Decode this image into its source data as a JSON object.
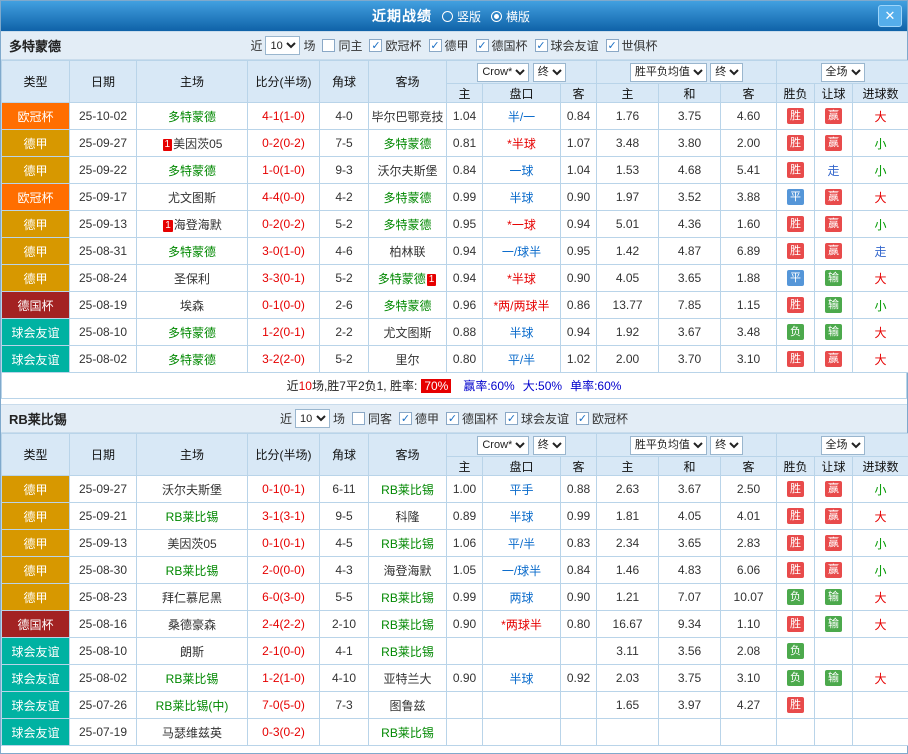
{
  "colors": {
    "leagues": {
      "欧冠杯": "#FF6E00",
      "德甲": "#D79800",
      "德国杯": "#A32222",
      "球会友谊": "#00B2A2"
    },
    "badge_win": "#E84B4B",
    "badge_draw": "#5596D8",
    "badge_loss": "#4CA94C",
    "text_big": "#E60000",
    "text_small": "#009900",
    "text_push": "#3366CC",
    "score": "#E60000",
    "focus_team": "#008800",
    "titlebar": "#1E7CC0"
  },
  "icons": {
    "check": "✓",
    "close": "✕"
  },
  "titlebar": {
    "title": "近期战绩",
    "radios": [
      {
        "label": "竖版",
        "selected": false
      },
      {
        "label": "横版",
        "selected": true
      }
    ]
  },
  "table_header": {
    "type": "类型",
    "date": "日期",
    "home": "主场",
    "score": "比分(半场)",
    "corner": "角球",
    "away": "客场",
    "odds_source": "Crow*",
    "odds_final": "终",
    "avg_source": "胜平负均值",
    "avg_final": "终",
    "scope": "全场",
    "odds_home": "主",
    "odds_line": "盘口",
    "odds_away": "客",
    "avg_home": "主",
    "avg_draw": "和",
    "avg_away": "客",
    "result": "胜负",
    "handicap": "让球",
    "goals": "进球数"
  },
  "sections": [
    {
      "team": "多特蒙德",
      "filters": {
        "near": "近",
        "count": "10",
        "games": "场",
        "checks": [
          {
            "label": "同主",
            "checked": false
          },
          {
            "label": "欧冠杯",
            "checked": true
          },
          {
            "label": "德甲",
            "checked": true
          },
          {
            "label": "德国杯",
            "checked": true
          },
          {
            "label": "球会友谊",
            "checked": true
          },
          {
            "label": "世俱杯",
            "checked": true
          }
        ]
      },
      "rows": [
        {
          "league": "欧冠杯",
          "date": "25-10-02",
          "home": {
            "name": "多特蒙德",
            "focus": true
          },
          "score": "4-1(1-0)",
          "corner": "4-0",
          "away": {
            "name": "毕尔巴鄂竞技"
          },
          "odds": [
            "1.04",
            "半/一",
            "0.84"
          ],
          "avg": [
            "1.76",
            "3.75",
            "4.60"
          ],
          "result": "胜",
          "handicap": "赢",
          "goals": "大"
        },
        {
          "league": "德甲",
          "date": "25-09-27",
          "home": {
            "name": "美因茨05",
            "card": "1",
            "card_pos": "left"
          },
          "score": "0-2(0-2)",
          "corner": "7-5",
          "away": {
            "name": "多特蒙德",
            "focus": true
          },
          "odds": [
            "0.81",
            "*半球",
            "1.07"
          ],
          "avg": [
            "3.48",
            "3.80",
            "2.00"
          ],
          "result": "胜",
          "handicap": "赢",
          "goals": "小"
        },
        {
          "league": "德甲",
          "date": "25-09-22",
          "home": {
            "name": "多特蒙德",
            "focus": true
          },
          "score": "1-0(1-0)",
          "corner": "9-3",
          "away": {
            "name": "沃尔夫斯堡"
          },
          "odds": [
            "0.84",
            "一球",
            "1.04"
          ],
          "avg": [
            "1.53",
            "4.68",
            "5.41"
          ],
          "result": "胜",
          "handicap": "走",
          "goals": "小"
        },
        {
          "league": "欧冠杯",
          "date": "25-09-17",
          "home": {
            "name": "尤文图斯"
          },
          "score": "4-4(0-0)",
          "corner": "4-2",
          "away": {
            "name": "多特蒙德",
            "focus": true
          },
          "odds": [
            "0.99",
            "半球",
            "0.90"
          ],
          "avg": [
            "1.97",
            "3.52",
            "3.88"
          ],
          "result": "平",
          "handicap": "赢",
          "goals": "大"
        },
        {
          "league": "德甲",
          "date": "25-09-13",
          "home": {
            "name": "海登海默",
            "card": "1",
            "card_pos": "left"
          },
          "score": "0-2(0-2)",
          "corner": "5-2",
          "away": {
            "name": "多特蒙德",
            "focus": true
          },
          "odds": [
            "0.95",
            "*一球",
            "0.94"
          ],
          "avg": [
            "5.01",
            "4.36",
            "1.60"
          ],
          "result": "胜",
          "handicap": "赢",
          "goals": "小"
        },
        {
          "league": "德甲",
          "date": "25-08-31",
          "home": {
            "name": "多特蒙德",
            "focus": true
          },
          "score": "3-0(1-0)",
          "corner": "4-6",
          "away": {
            "name": "柏林联"
          },
          "odds": [
            "0.94",
            "一/球半",
            "0.95"
          ],
          "avg": [
            "1.42",
            "4.87",
            "6.89"
          ],
          "result": "胜",
          "handicap": "赢",
          "goals": "走"
        },
        {
          "league": "德甲",
          "date": "25-08-24",
          "home": {
            "name": "圣保利"
          },
          "score": "3-3(0-1)",
          "corner": "5-2",
          "away": {
            "name": "多特蒙德",
            "focus": true,
            "card": "1",
            "card_pos": "right"
          },
          "odds": [
            "0.94",
            "*半球",
            "0.90"
          ],
          "avg": [
            "4.05",
            "3.65",
            "1.88"
          ],
          "result": "平",
          "handicap": "输",
          "goals": "大"
        },
        {
          "league": "德国杯",
          "date": "25-08-19",
          "home": {
            "name": "埃森"
          },
          "score": "0-1(0-0)",
          "corner": "2-6",
          "away": {
            "name": "多特蒙德",
            "focus": true
          },
          "odds": [
            "0.96",
            "*两/两球半",
            "0.86"
          ],
          "avg": [
            "13.77",
            "7.85",
            "1.15"
          ],
          "result": "胜",
          "handicap": "输",
          "goals": "小"
        },
        {
          "league": "球会友谊",
          "date": "25-08-10",
          "home": {
            "name": "多特蒙德",
            "focus": true
          },
          "score": "1-2(0-1)",
          "corner": "2-2",
          "away": {
            "name": "尤文图斯"
          },
          "odds": [
            "0.88",
            "半球",
            "0.94"
          ],
          "avg": [
            "1.92",
            "3.67",
            "3.48"
          ],
          "result": "负",
          "handicap": "输",
          "goals": "大"
        },
        {
          "league": "球会友谊",
          "date": "25-08-02",
          "home": {
            "name": "多特蒙德",
            "focus": true
          },
          "score": "3-2(2-0)",
          "corner": "5-2",
          "away": {
            "name": "里尔"
          },
          "odds": [
            "0.80",
            "平/半",
            "1.02"
          ],
          "avg": [
            "2.00",
            "3.70",
            "3.10"
          ],
          "result": "胜",
          "handicap": "赢",
          "goals": "大"
        }
      ],
      "summary": [
        {
          "text": "近",
          "style": "plain"
        },
        {
          "text": "10",
          "style": "red"
        },
        {
          "text": "场,胜7平2负1, 胜率:",
          "style": "plain"
        },
        {
          "text": "70%",
          "style": "badge"
        },
        {
          "text": "赢率:60%",
          "style": "blue"
        },
        {
          "text": "大:50%",
          "style": "blue"
        },
        {
          "text": "单率:60%",
          "style": "blue"
        }
      ]
    },
    {
      "team": "RB莱比锡",
      "filters": {
        "near": "近",
        "count": "10",
        "games": "场",
        "checks": [
          {
            "label": "同客",
            "checked": false
          },
          {
            "label": "德甲",
            "checked": true
          },
          {
            "label": "德国杯",
            "checked": true
          },
          {
            "label": "球会友谊",
            "checked": true
          },
          {
            "label": "欧冠杯",
            "checked": true
          }
        ]
      },
      "rows": [
        {
          "league": "德甲",
          "date": "25-09-27",
          "home": {
            "name": "沃尔夫斯堡"
          },
          "score": "0-1(0-1)",
          "corner": "6-11",
          "away": {
            "name": "RB莱比锡",
            "focus": true
          },
          "odds": [
            "1.00",
            "平手",
            "0.88"
          ],
          "avg": [
            "2.63",
            "3.67",
            "2.50"
          ],
          "result": "胜",
          "handicap": "赢",
          "goals": "小"
        },
        {
          "league": "德甲",
          "date": "25-09-21",
          "home": {
            "name": "RB莱比锡",
            "focus": true
          },
          "score": "3-1(3-1)",
          "corner": "9-5",
          "away": {
            "name": "科隆"
          },
          "odds": [
            "0.89",
            "半球",
            "0.99"
          ],
          "avg": [
            "1.81",
            "4.05",
            "4.01"
          ],
          "result": "胜",
          "handicap": "赢",
          "goals": "大"
        },
        {
          "league": "德甲",
          "date": "25-09-13",
          "home": {
            "name": "美因茨05"
          },
          "score": "0-1(0-1)",
          "corner": "4-5",
          "away": {
            "name": "RB莱比锡",
            "focus": true
          },
          "odds": [
            "1.06",
            "平/半",
            "0.83"
          ],
          "avg": [
            "2.34",
            "3.65",
            "2.83"
          ],
          "result": "胜",
          "handicap": "赢",
          "goals": "小"
        },
        {
          "league": "德甲",
          "date": "25-08-30",
          "home": {
            "name": "RB莱比锡",
            "focus": true
          },
          "score": "2-0(0-0)",
          "corner": "4-3",
          "away": {
            "name": "海登海默"
          },
          "odds": [
            "1.05",
            "一/球半",
            "0.84"
          ],
          "avg": [
            "1.46",
            "4.83",
            "6.06"
          ],
          "result": "胜",
          "handicap": "赢",
          "goals": "小"
        },
        {
          "league": "德甲",
          "date": "25-08-23",
          "home": {
            "name": "拜仁慕尼黑"
          },
          "score": "6-0(3-0)",
          "corner": "5-5",
          "away": {
            "name": "RB莱比锡",
            "focus": true
          },
          "odds": [
            "0.99",
            "两球",
            "0.90"
          ],
          "avg": [
            "1.21",
            "7.07",
            "10.07"
          ],
          "result": "负",
          "handicap": "输",
          "goals": "大"
        },
        {
          "league": "德国杯",
          "date": "25-08-16",
          "home": {
            "name": "桑德豪森"
          },
          "score": "2-4(2-2)",
          "corner": "2-10",
          "away": {
            "name": "RB莱比锡",
            "focus": true
          },
          "odds": [
            "0.90",
            "*两球半",
            "0.80"
          ],
          "avg": [
            "16.67",
            "9.34",
            "1.10"
          ],
          "result": "胜",
          "handicap": "输",
          "goals": "大"
        },
        {
          "league": "球会友谊",
          "date": "25-08-10",
          "home": {
            "name": "朗斯"
          },
          "score": "2-1(0-0)",
          "corner": "4-1",
          "away": {
            "name": "RB莱比锡",
            "focus": true
          },
          "odds": [
            "",
            "",
            ""
          ],
          "avg": [
            "3.11",
            "3.56",
            "2.08"
          ],
          "result": "负",
          "handicap": "",
          "goals": ""
        },
        {
          "league": "球会友谊",
          "date": "25-08-02",
          "home": {
            "name": "RB莱比锡",
            "focus": true
          },
          "score": "1-2(1-0)",
          "corner": "4-10",
          "away": {
            "name": "亚特兰大"
          },
          "odds": [
            "0.90",
            "半球",
            "0.92"
          ],
          "avg": [
            "2.03",
            "3.75",
            "3.10"
          ],
          "result": "负",
          "handicap": "输",
          "goals": "大"
        },
        {
          "league": "球会友谊",
          "date": "25-07-26",
          "home": {
            "name": "RB莱比锡(中)",
            "focus": true
          },
          "score": "7-0(5-0)",
          "corner": "7-3",
          "away": {
            "name": "图鲁兹"
          },
          "odds": [
            "",
            "",
            ""
          ],
          "avg": [
            "1.65",
            "3.97",
            "4.27"
          ],
          "result": "胜",
          "handicap": "",
          "goals": ""
        },
        {
          "league": "球会友谊",
          "date": "25-07-19",
          "home": {
            "name": "马瑟维兹英"
          },
          "score": "0-3(0-2)",
          "corner": "",
          "away": {
            "name": "RB莱比锡",
            "focus": true
          },
          "odds": [
            "",
            "",
            ""
          ],
          "avg": [
            "",
            "",
            ""
          ],
          "result": "",
          "handicap": "",
          "goals": ""
        }
      ]
    }
  ]
}
